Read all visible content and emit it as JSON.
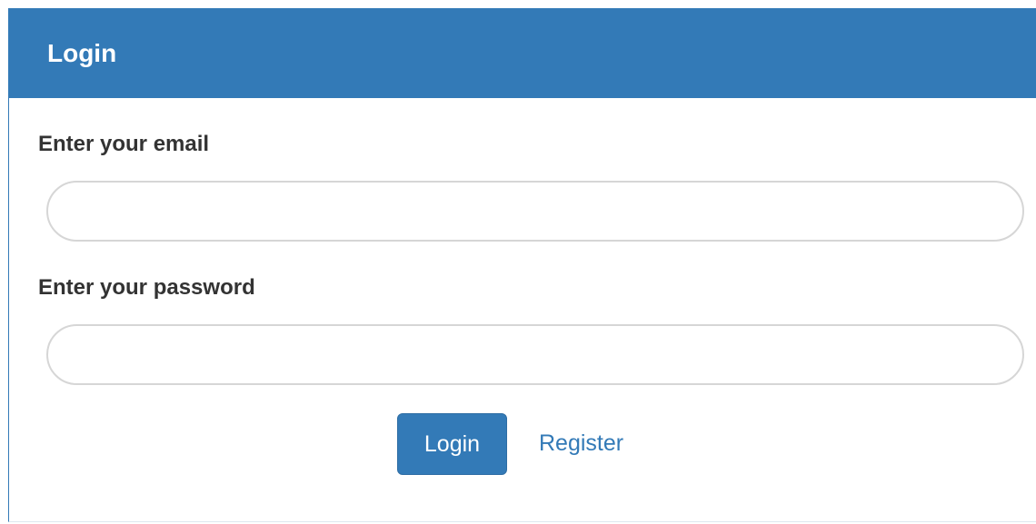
{
  "panel": {
    "title": "Login"
  },
  "form": {
    "email": {
      "label": "Enter your email",
      "value": "",
      "placeholder": ""
    },
    "password": {
      "label": "Enter your password",
      "value": "",
      "placeholder": ""
    },
    "login_button_label": "Login",
    "register_link_label": "Register"
  },
  "colors": {
    "primary": "#337ab7",
    "label_text": "#333333",
    "input_border": "#d6d6d6"
  }
}
